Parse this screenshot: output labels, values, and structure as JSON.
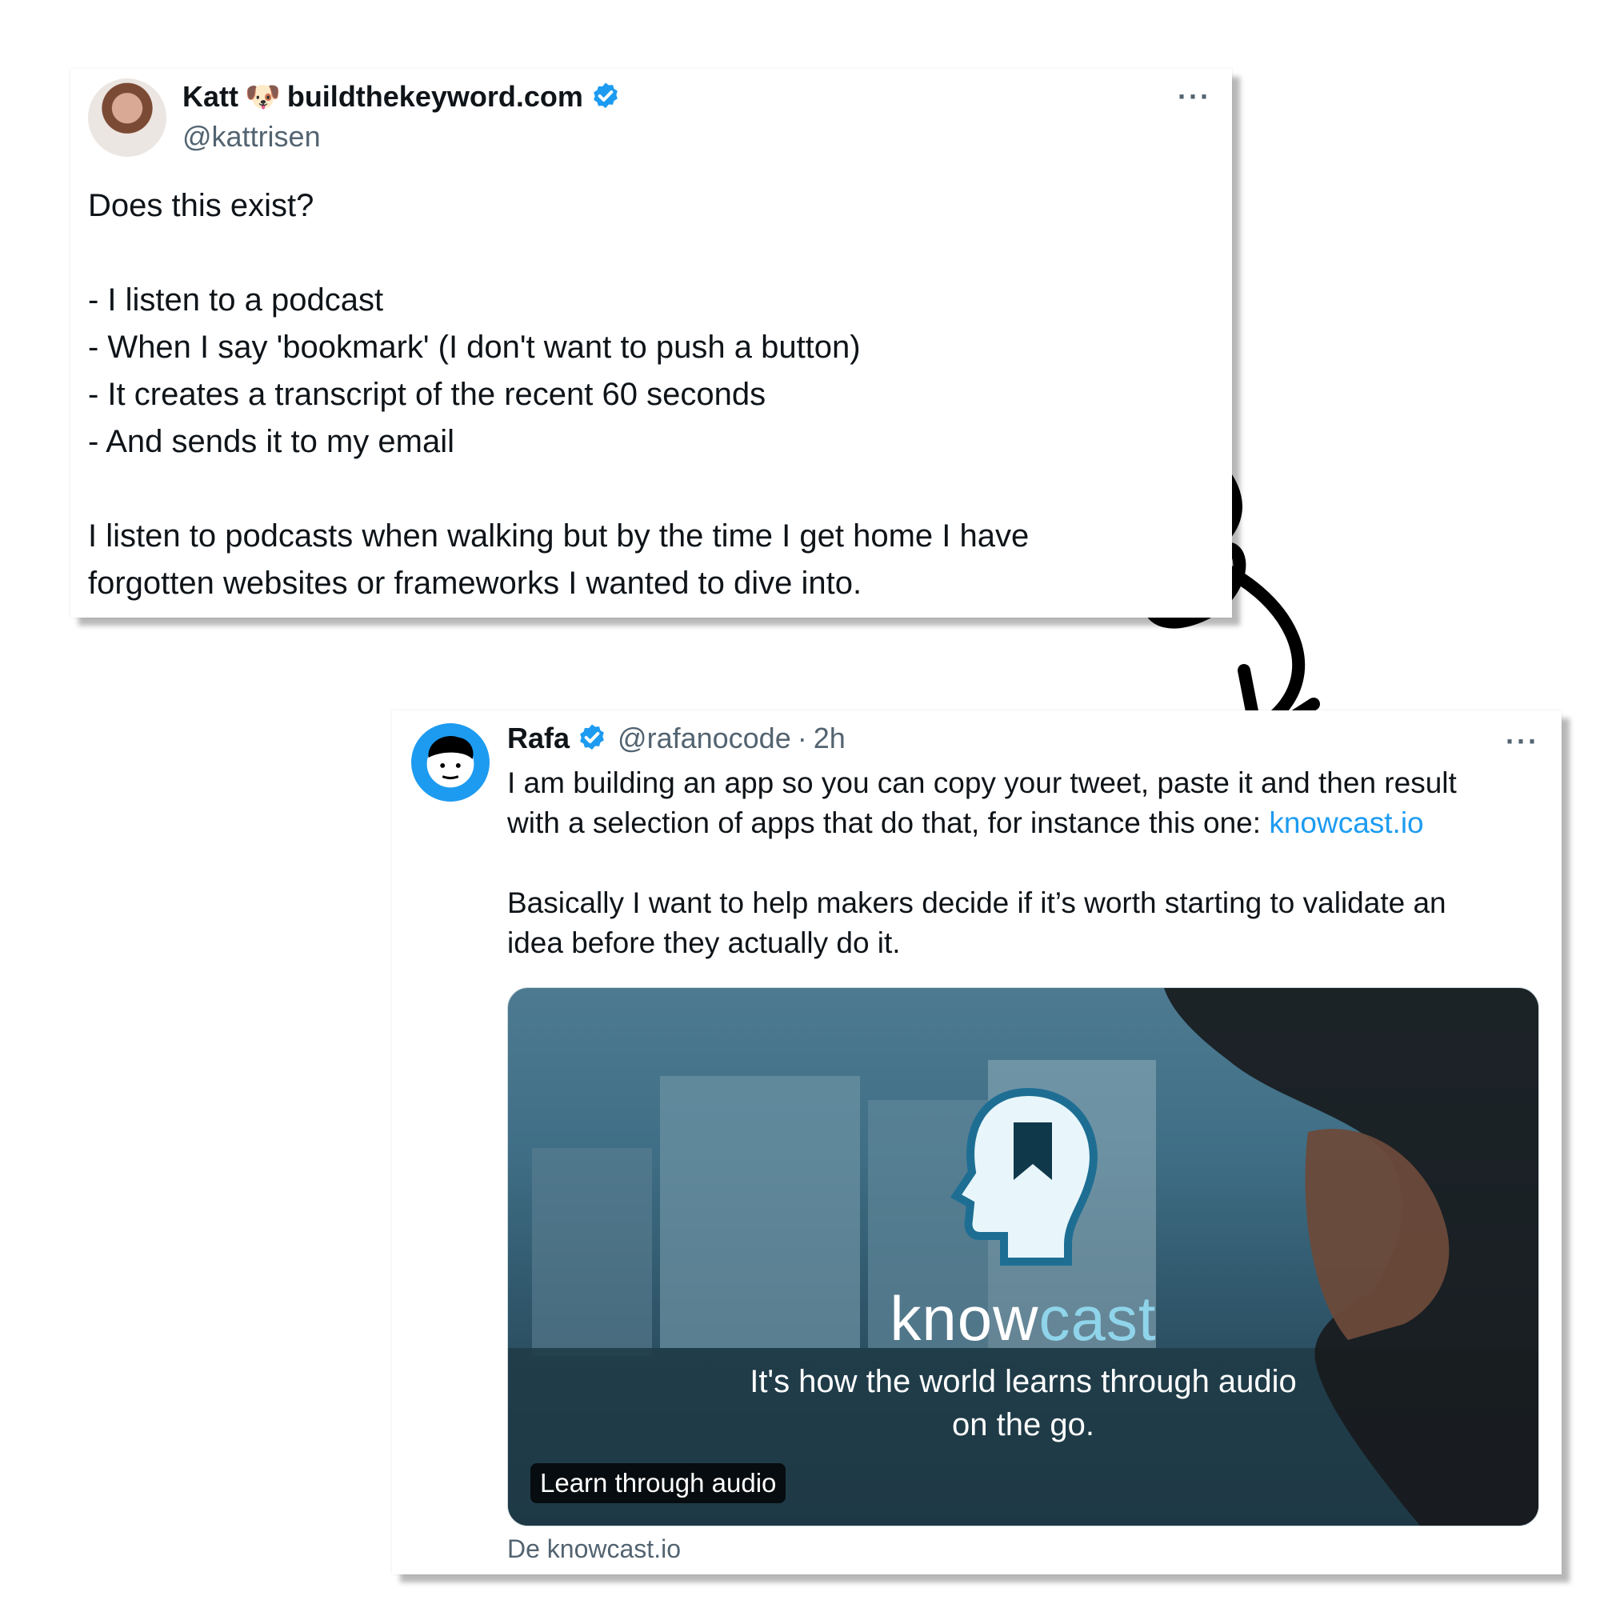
{
  "tweet1": {
    "display_name": "Katt",
    "name_emoji": "🐶",
    "name_suffix": "buildthekeyword.com",
    "handle": "@kattrisen",
    "more_label": "···",
    "text": "Does this exist?\n\n- I listen to a podcast\n- When I say 'bookmark' (I don't want to push a button)\n- It creates a transcript of the recent 60 seconds\n- And sends it to my email\n\nI listen to podcasts when walking but by the time I get home I have\nforgotten websites or frameworks I wanted to dive into."
  },
  "tweet2": {
    "display_name": "Rafa",
    "handle": "@rafanocode",
    "separator": "·",
    "time": "2h",
    "more_label": "···",
    "text_part1": "I am building an app so you can copy your tweet, paste it and then result\nwith a selection of apps that do that, for instance this one: ",
    "link_text": "knowcast.io",
    "text_part2": "\n\nBasically I want to help makers decide if it’s worth starting to validate an\nidea before they actually do it.",
    "card": {
      "brand_name_part1": "know",
      "brand_name_part2": "cast",
      "tagline_line1": "It's how the world learns through audio",
      "tagline_line2": "on the go.",
      "badge": "Learn through audio"
    },
    "source": "De knowcast.io"
  },
  "colors": {
    "link": "#1d9bf0",
    "verified": "#1d9bf0",
    "secondary_text": "#536471",
    "accent_cyan": "#8fd4ea"
  },
  "icons": [
    "verified-badge-icon",
    "more-options-icon",
    "knowcast-logo-icon",
    "curved-arrow-icon"
  ]
}
